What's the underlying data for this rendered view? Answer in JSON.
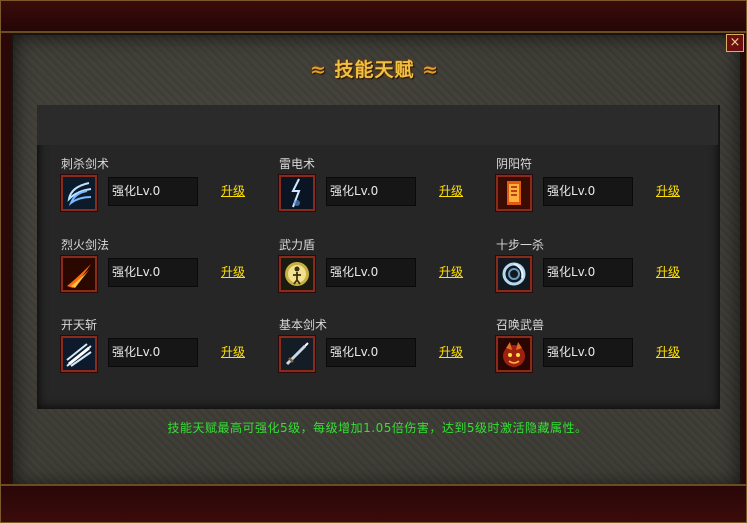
{
  "window": {
    "title_left": "≈",
    "title_text": "技能天赋",
    "title_right": "≈",
    "close_label": "×"
  },
  "skills": [
    {
      "name": "刺杀剑术",
      "level": "强化Lv.0",
      "upgrade": "升级",
      "icon": "thrust-slash-icon"
    },
    {
      "name": "雷电术",
      "level": "强化Lv.0",
      "upgrade": "升级",
      "icon": "lightning-icon"
    },
    {
      "name": "阴阳符",
      "level": "强化Lv.0",
      "upgrade": "升级",
      "icon": "talisman-icon"
    },
    {
      "name": "烈火剑法",
      "level": "强化Lv.0",
      "upgrade": "升级",
      "icon": "fire-sword-icon"
    },
    {
      "name": "武力盾",
      "level": "强化Lv.0",
      "upgrade": "升级",
      "icon": "shield-figure-icon"
    },
    {
      "name": "十步一杀",
      "level": "强化Lv.0",
      "upgrade": "升级",
      "icon": "vortex-icon"
    },
    {
      "name": "开天斩",
      "level": "强化Lv.0",
      "upgrade": "升级",
      "icon": "heaven-slash-icon"
    },
    {
      "name": "基本剑术",
      "level": "强化Lv.0",
      "upgrade": "升级",
      "icon": "basic-sword-icon"
    },
    {
      "name": "召唤武兽",
      "level": "强化Lv.0",
      "upgrade": "升级",
      "icon": "summon-beast-icon"
    }
  ],
  "note": "技能天赋最高可强化5级，每级增加1.05倍伤害，达到5级时激活隐藏属性。",
  "colors": {
    "title": "#f0c040",
    "upgrade_link": "#ffe000",
    "note": "#33e033",
    "icon_border": "#8a2a1a"
  }
}
